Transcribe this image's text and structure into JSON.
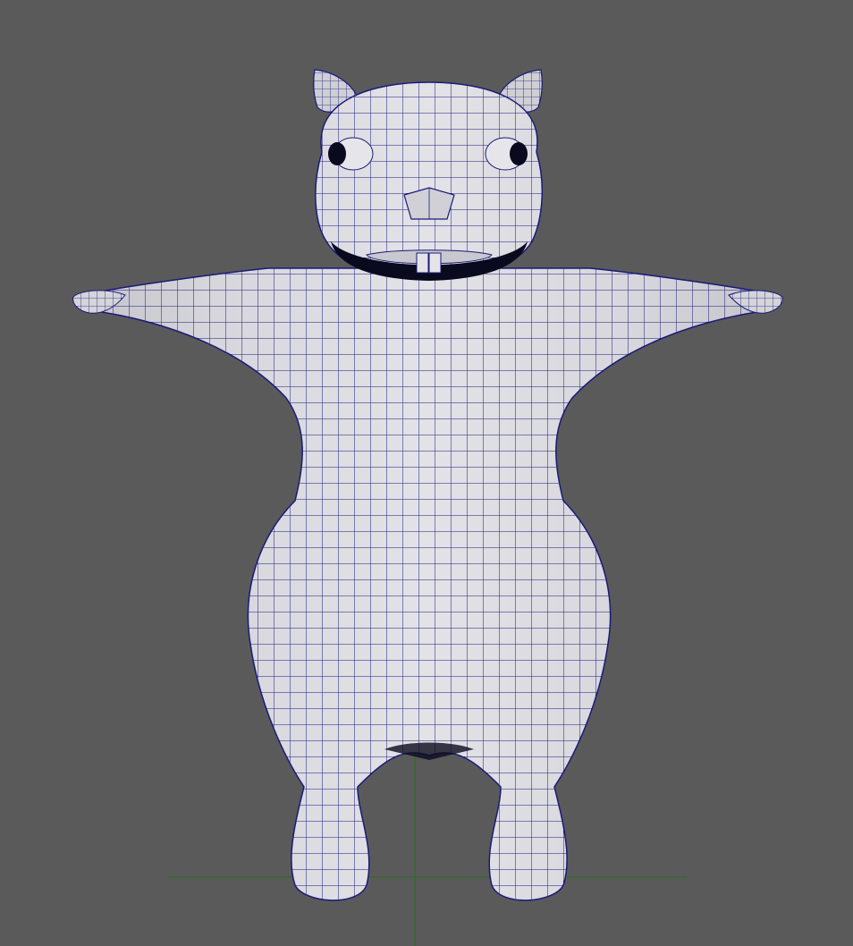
{
  "viewport": {
    "background": "#5a5a5a",
    "mesh_fill": "#d4d4d9",
    "mesh_shade": "#b5b5bc",
    "wire_color": "#1a1a7a",
    "grid_axis_color": "#2f6b2f",
    "eye_color": "#0a0a1e",
    "tooth_color": "#e4e4e8"
  },
  "model": {
    "display_mode": "smooth-shaded-with-wireframe",
    "pose": "t-pose",
    "parts": [
      "head",
      "ears",
      "eyes",
      "nose",
      "teeth",
      "torso",
      "arms",
      "hands",
      "legs",
      "feet"
    ]
  }
}
